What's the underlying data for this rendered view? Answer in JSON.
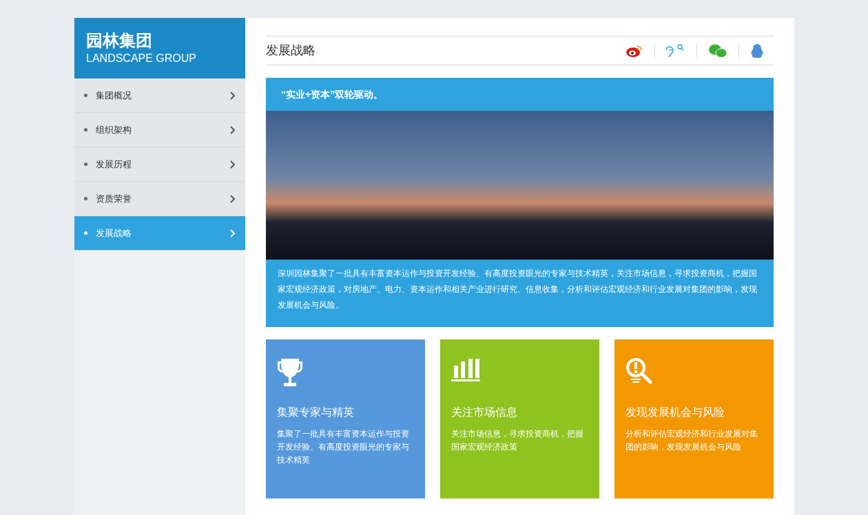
{
  "brand": {
    "title": "园林集团",
    "subtitle": "LANDSCAPE GROUP"
  },
  "nav": [
    {
      "label": "集团概况",
      "selected": false
    },
    {
      "label": "组织架构",
      "selected": false
    },
    {
      "label": "发展历程",
      "selected": false
    },
    {
      "label": "资质荣誉",
      "selected": false
    },
    {
      "label": "发展战略",
      "selected": true
    }
  ],
  "page_title": "发展战略",
  "banner": {
    "headline": "“实业+资本”双轮驱动。",
    "body": "深圳园林集聚了一批具有丰富资本运作与投资开发经验、有高度投资眼光的专家与技术精英，关注市场信息，寻求投资商机，把握国家宏观经济政策，对房地产、电力、资本运作和相关产业进行研究、信息收集，分析和评估宏观经济和行业发展对集团的影响，发现发展机会与风险。"
  },
  "cards": [
    {
      "kind": "trophy",
      "color": "#5598db",
      "title": "集聚专家与精英",
      "text": "集聚了一批具有丰富资本运作与投资开发经验、有高度投资眼光的专家与技术精英"
    },
    {
      "kind": "chart",
      "color": "#8fc31f",
      "title": "关注市场信息",
      "text": "关注市场信息，寻求投资商机，把握国家宏观经济政策"
    },
    {
      "kind": "search",
      "color": "#f39800",
      "title": "发现发展机会与风险",
      "text": "分析和评估宏观经济和行业发展对集团的影响，发现发展机会与风险"
    }
  ]
}
